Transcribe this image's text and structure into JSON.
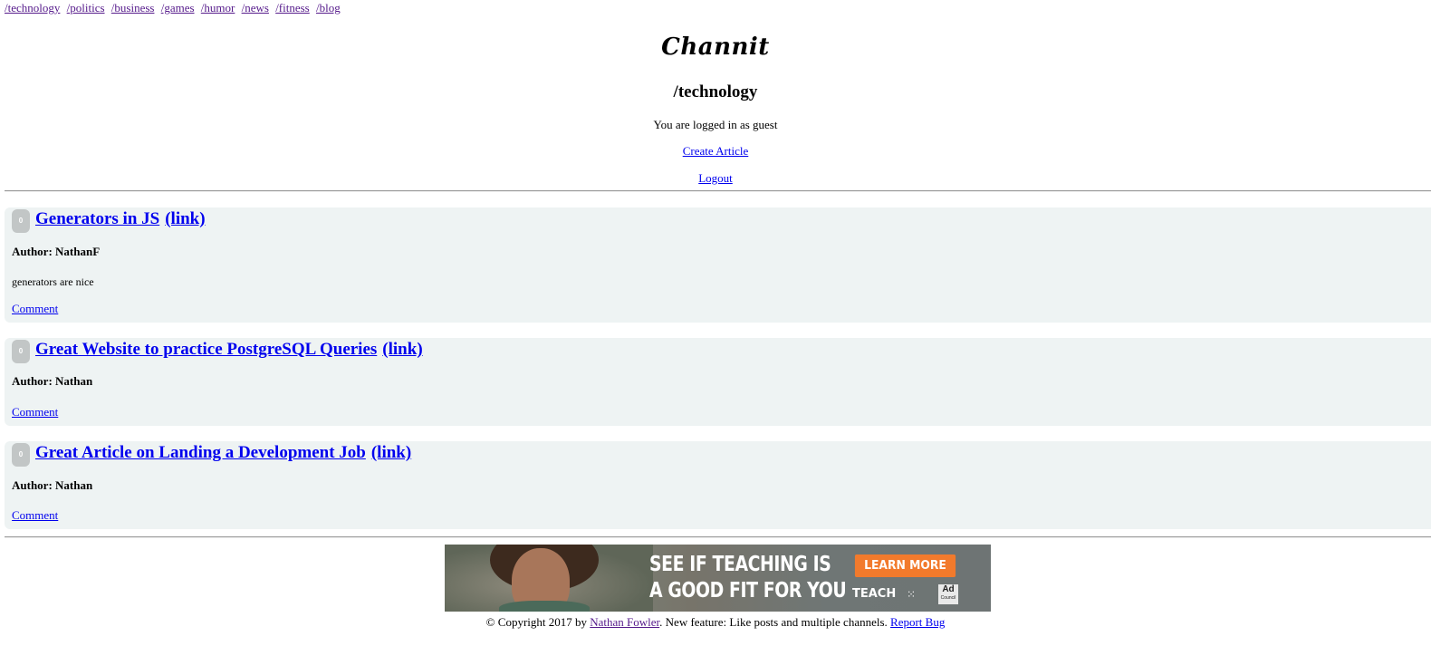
{
  "nav": {
    "channels": [
      "/technology",
      "/politics",
      "/business",
      "/games",
      "/humor",
      "/news",
      "/fitness",
      "/blog"
    ]
  },
  "header": {
    "logo": "Channit",
    "channel_title": "/technology",
    "login_status": "You are logged in as guest",
    "create_article": "Create Article",
    "logout": "Logout"
  },
  "articles": [
    {
      "votes": "0",
      "title": "Generators in JS",
      "link_label": "(link)",
      "author": "Author: NathanF",
      "body": "generators are nice",
      "comment_label": "Comment"
    },
    {
      "votes": "0",
      "title": "Great Website to practice PostgreSQL Queries",
      "link_label": "(link)",
      "author": "Author: Nathan",
      "body": "",
      "comment_label": "Comment"
    },
    {
      "votes": "0",
      "title": "Great Article on Landing a Development Job",
      "link_label": "(link)",
      "author": "Author: Nathan",
      "body": "",
      "comment_label": "Comment"
    }
  ],
  "ad": {
    "headline_line1": "SEE IF TEACHING IS",
    "headline_line2": "A GOOD FIT FOR YOU",
    "cta": "LEARN MORE",
    "brand": "TEACH",
    "council": "Ad",
    "council_small": "Council",
    "accent_color": "#f27a2c"
  },
  "footer": {
    "prefix": "© Copyright 2017 by ",
    "author_link": "Nathan Fowler",
    "middle": ". New feature: Like posts and multiple channels. ",
    "report_bug": "Report Bug"
  }
}
